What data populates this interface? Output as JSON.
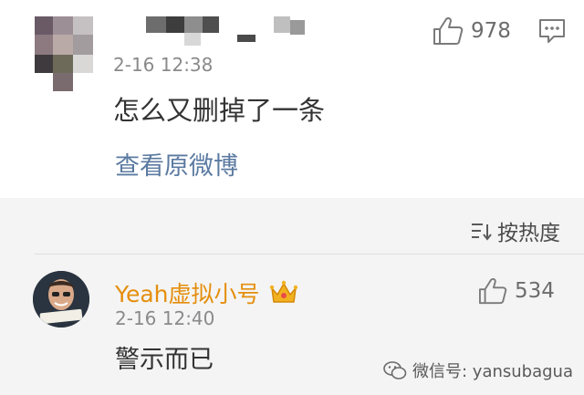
{
  "post": {
    "time": "2-16 12:38",
    "text": "怎么又删掉了一条",
    "view_original": "查看原微博",
    "likes": "978"
  },
  "sort": {
    "label": "按热度"
  },
  "comment": {
    "username": "Yeah虚拟小号",
    "time": "2-16 12:40",
    "text": "警示而已",
    "likes": "534"
  },
  "watermark": {
    "text": "微信号: yansubagua"
  },
  "colors": {
    "link": "#5b7aa1",
    "username": "#e58e0c",
    "crown": "#f2b21f",
    "secondary": "#8a8a8a"
  },
  "icons": [
    "thumbs-up-icon",
    "comment-icon",
    "sort-icon",
    "crown-icon",
    "wechat-icon"
  ]
}
